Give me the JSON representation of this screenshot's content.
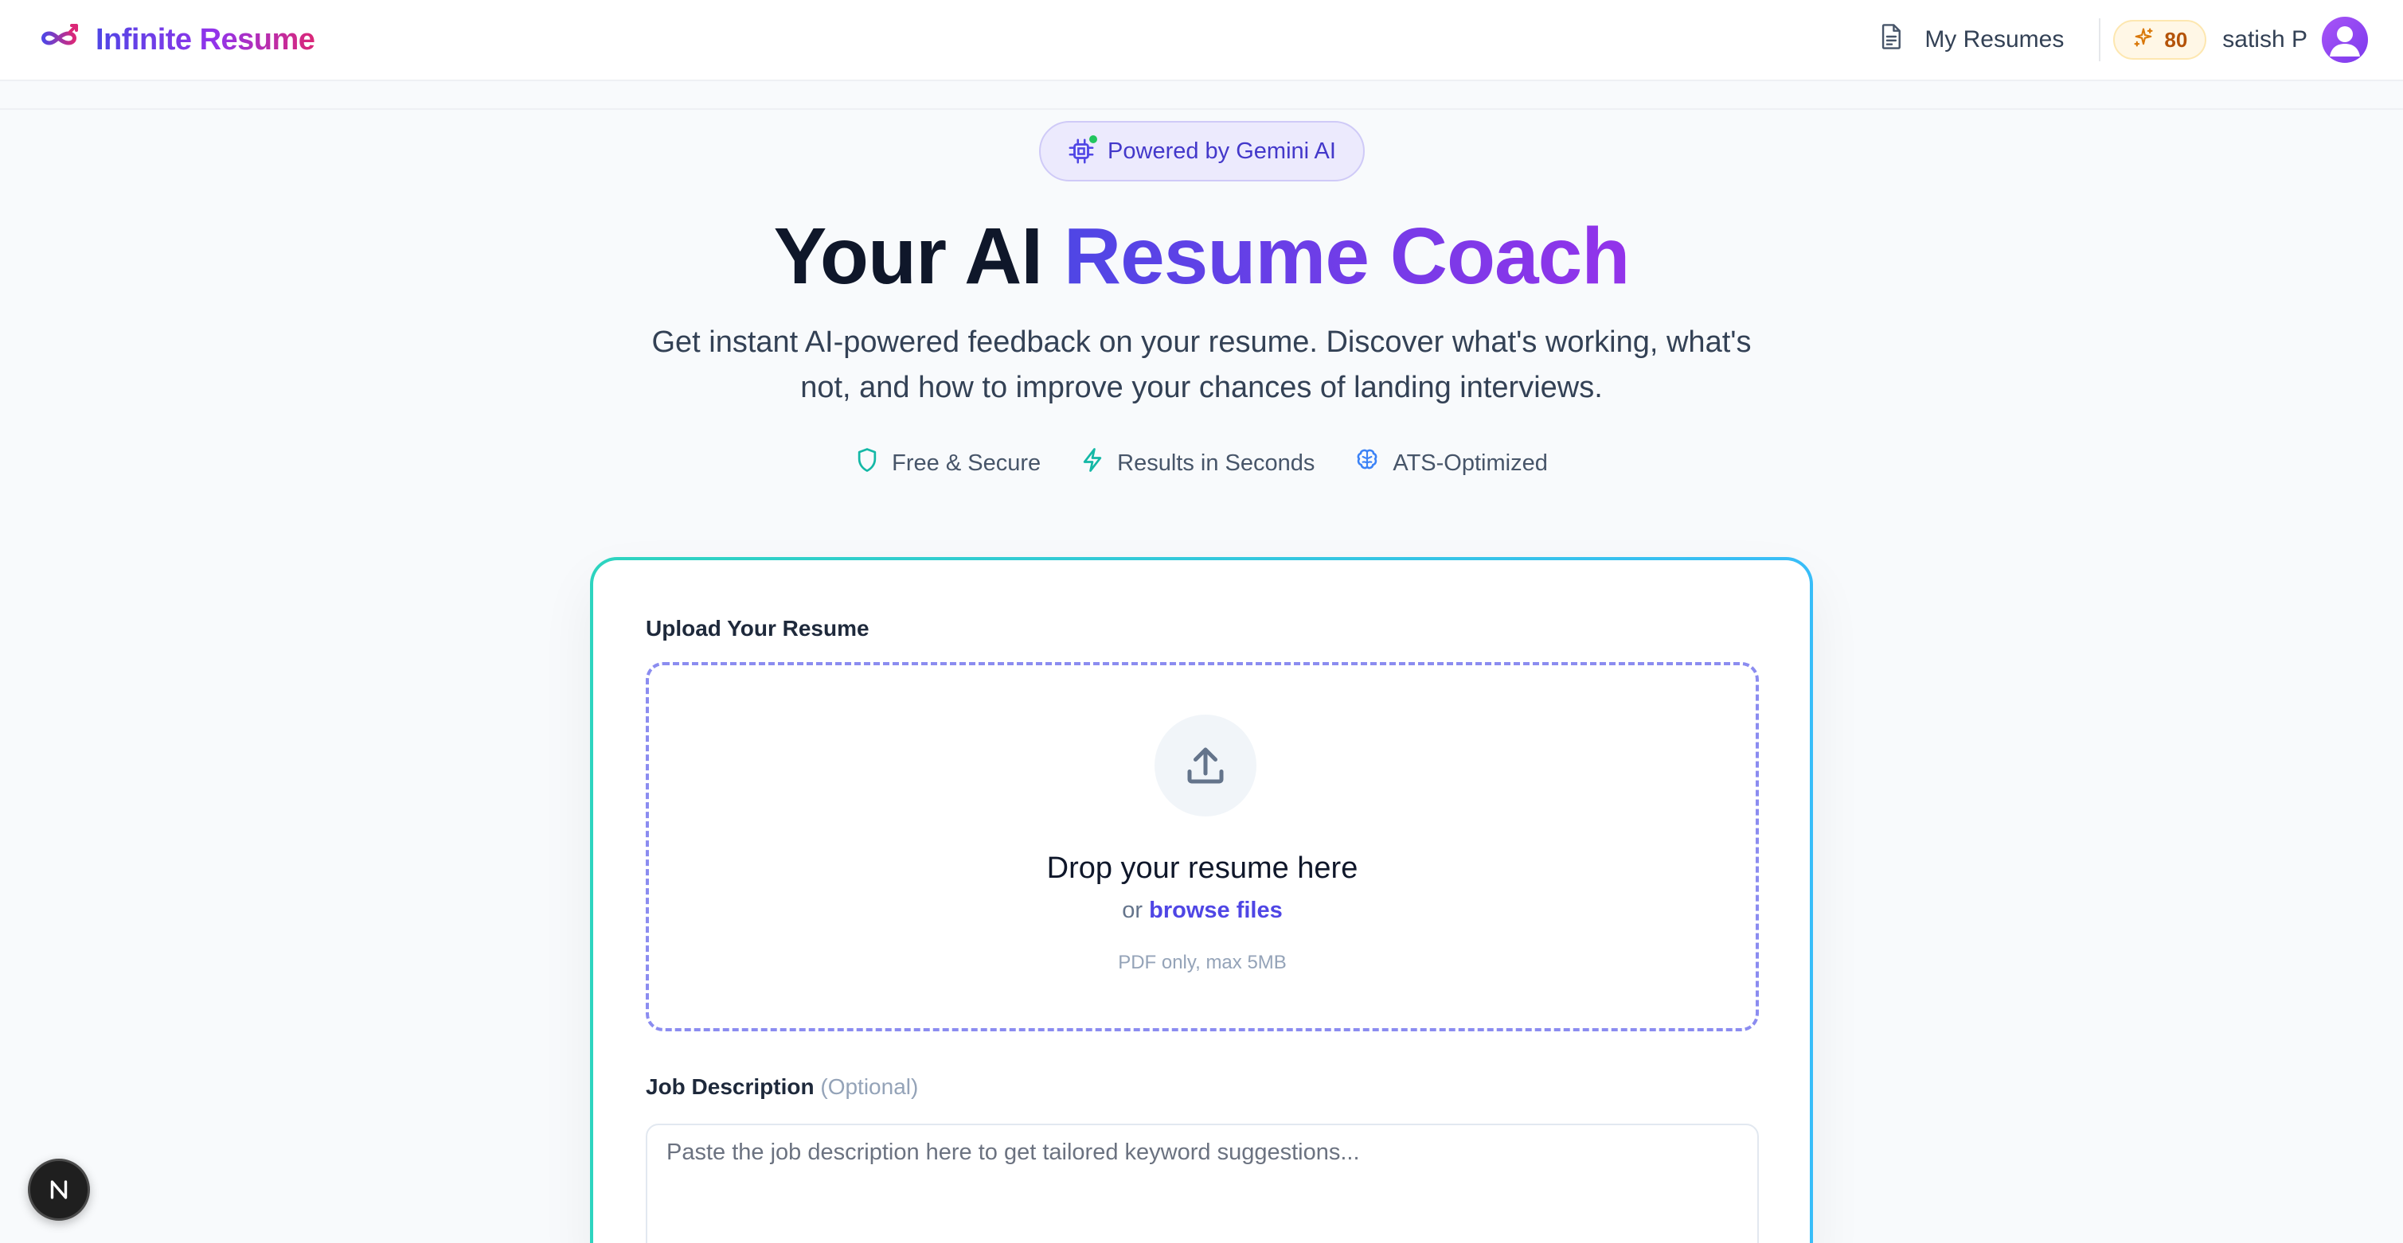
{
  "header": {
    "brand_name": "Infinite Resume",
    "nav_my_resumes": "My Resumes",
    "credits": "80",
    "user_name": "satish P"
  },
  "hero": {
    "badge": "Powered by Gemini AI",
    "title_part1": "Your AI ",
    "title_part2": "Resume Coach",
    "subtitle": "Get instant AI-powered feedback on your resume. Discover what's working, what's not, and how to improve your chances of landing interviews.",
    "features": [
      {
        "label": "Free & Secure",
        "icon": "shield-icon"
      },
      {
        "label": "Results in Seconds",
        "icon": "lightning-icon"
      },
      {
        "label": "ATS-Optimized",
        "icon": "brain-icon"
      }
    ]
  },
  "upload": {
    "label": "Upload Your Resume",
    "drop_title": "Drop your resume here",
    "or_text": "or ",
    "browse_link": "browse files",
    "hint": "PDF only, max 5MB"
  },
  "job_description": {
    "label": "Job Description",
    "optional": "(Optional)",
    "placeholder": "Paste the job description here to get tailored keyword suggestions...",
    "value": ""
  },
  "dev_indicator": {
    "letter": "N"
  },
  "colors": {
    "accent": "#4f46e5",
    "accent_purple": "#9333ea",
    "card_border_start": "#2dd4bf",
    "card_border_end": "#38bdf8",
    "dropzone_border": "#8b8cf0",
    "credits_text": "#b45309"
  }
}
